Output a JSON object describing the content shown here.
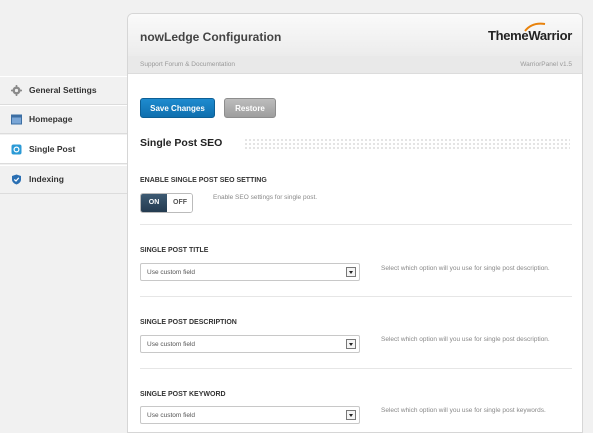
{
  "sidebar": {
    "items": [
      {
        "label": "General Settings"
      },
      {
        "label": "Homepage"
      },
      {
        "label": "Single Post"
      },
      {
        "label": "Indexing"
      }
    ]
  },
  "header": {
    "title": "nowLedge Configuration",
    "logo_part1": "Theme",
    "logo_part2": "Warrior",
    "support_link": "Support Forum & Documentation",
    "version": "WarriorPanel v1.5"
  },
  "actions": {
    "save_label": "Save Changes",
    "restore_label": "Restore"
  },
  "section": {
    "title": "Single Post SEO"
  },
  "settings": {
    "seo_enable": {
      "label": "ENABLE SINGLE POST SEO SETTING",
      "on_label": "ON",
      "off_label": "OFF",
      "description": "Enable SEO settings for single post."
    },
    "title": {
      "label": "SINGLE POST TITLE",
      "value": "Use custom field",
      "description": "Select which option will you use for single post description."
    },
    "description": {
      "label": "SINGLE POST DESCRIPTION",
      "value": "Use custom field",
      "description": "Select which option will you use for single post description."
    },
    "keyword": {
      "label": "SINGLE POST KEYWORD",
      "value": "Use custom field",
      "description": "Select which option will you use for single post keywords."
    }
  },
  "colors": {
    "accent": "#1279c0",
    "active_toggle": "#2f4a62"
  }
}
